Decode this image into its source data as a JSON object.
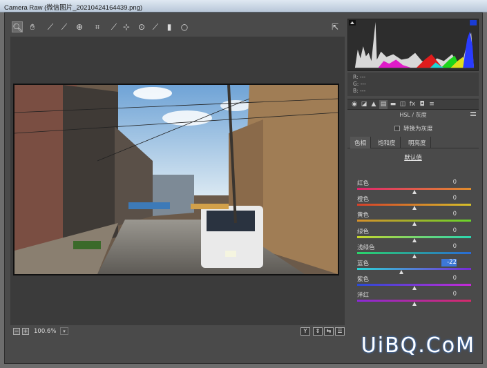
{
  "window": {
    "title": "Camera Raw (微信图片_20210424164439.png)"
  },
  "toolbar": {
    "tools": [
      {
        "icon": "zoom-icon",
        "glyph": "🔍︎"
      },
      {
        "icon": "hand-icon",
        "glyph": "✋︎"
      },
      {
        "icon": "white-balance-icon",
        "glyph": "⟋"
      },
      {
        "icon": "color-sampler-icon",
        "glyph": "⟋"
      },
      {
        "icon": "target-adjust-icon",
        "glyph": "⊕"
      },
      {
        "icon": "crop-icon",
        "glyph": "⌗"
      },
      {
        "icon": "straighten-icon",
        "glyph": "⟋"
      },
      {
        "icon": "spot-removal-icon",
        "glyph": "⊹"
      },
      {
        "icon": "redeye-icon",
        "glyph": "⊙"
      },
      {
        "icon": "adjustment-brush-icon",
        "glyph": "⟋"
      },
      {
        "icon": "graduated-filter-icon",
        "glyph": "▮"
      },
      {
        "icon": "radial-filter-icon",
        "glyph": "○"
      }
    ],
    "open_icon": "open-preferences-icon"
  },
  "status": {
    "zoom": "100.6%",
    "zoom_out": "−",
    "zoom_in": "+",
    "dd": "▾"
  },
  "view_buttons": [
    {
      "icon": "y-toggle-icon",
      "glyph": "Y"
    },
    {
      "icon": "swap-icon",
      "glyph": "⇕"
    },
    {
      "icon": "copy-settings-icon",
      "glyph": "⇆"
    },
    {
      "icon": "settings-icon",
      "glyph": "☰"
    }
  ],
  "rgb": {
    "r": "R:  ---",
    "g": "G:  ---",
    "b": "B:  ---"
  },
  "panel_tabs": [
    {
      "icon": "basic-icon",
      "glyph": "◉"
    },
    {
      "icon": "tone-curve-icon",
      "glyph": "◪"
    },
    {
      "icon": "detail-icon",
      "glyph": "▲"
    },
    {
      "icon": "hsl-icon",
      "glyph": "▤"
    },
    {
      "icon": "split-toning-icon",
      "glyph": "▬"
    },
    {
      "icon": "lens-icon",
      "glyph": "◫"
    },
    {
      "icon": "fx-icon",
      "glyph": "fx"
    },
    {
      "icon": "camera-calibration-icon",
      "glyph": "◘"
    },
    {
      "icon": "presets-icon",
      "glyph": "≡"
    }
  ],
  "panel": {
    "title": "HSL / 灰度",
    "grayscale_label": "转换为灰度",
    "sub_tabs": [
      "色相",
      "饱和度",
      "明亮度"
    ],
    "defaults_link": "默认值",
    "sliders": [
      {
        "label": "红色",
        "value": "0",
        "level": 0.5,
        "gradient": [
          "#e0266e",
          "#e08d2c"
        ]
      },
      {
        "label": "橙色",
        "value": "0",
        "level": 0.5,
        "gradient": [
          "#d6402a",
          "#d6c02a"
        ]
      },
      {
        "label": "黄色",
        "value": "0",
        "level": 0.5,
        "gradient": [
          "#d6902a",
          "#6ad62a"
        ]
      },
      {
        "label": "绿色",
        "value": "0",
        "level": 0.5,
        "gradient": [
          "#c8d62a",
          "#2ad6b0"
        ]
      },
      {
        "label": "浅绿色",
        "value": "0",
        "level": 0.5,
        "gradient": [
          "#2ad66a",
          "#2a6ad6"
        ]
      },
      {
        "label": "蓝色",
        "value": "-22",
        "level": 0.39,
        "gradient": [
          "#2ad6d6",
          "#7a2ad6"
        ],
        "selected": true
      },
      {
        "label": "紫色",
        "value": "0",
        "level": 0.5,
        "gradient": [
          "#2a4ad6",
          "#c62ad6"
        ]
      },
      {
        "label": "洋红",
        "value": "0",
        "level": 0.5,
        "gradient": [
          "#8a2ad6",
          "#d62a6a"
        ]
      }
    ]
  },
  "watermark": "UiBQ.CoM"
}
